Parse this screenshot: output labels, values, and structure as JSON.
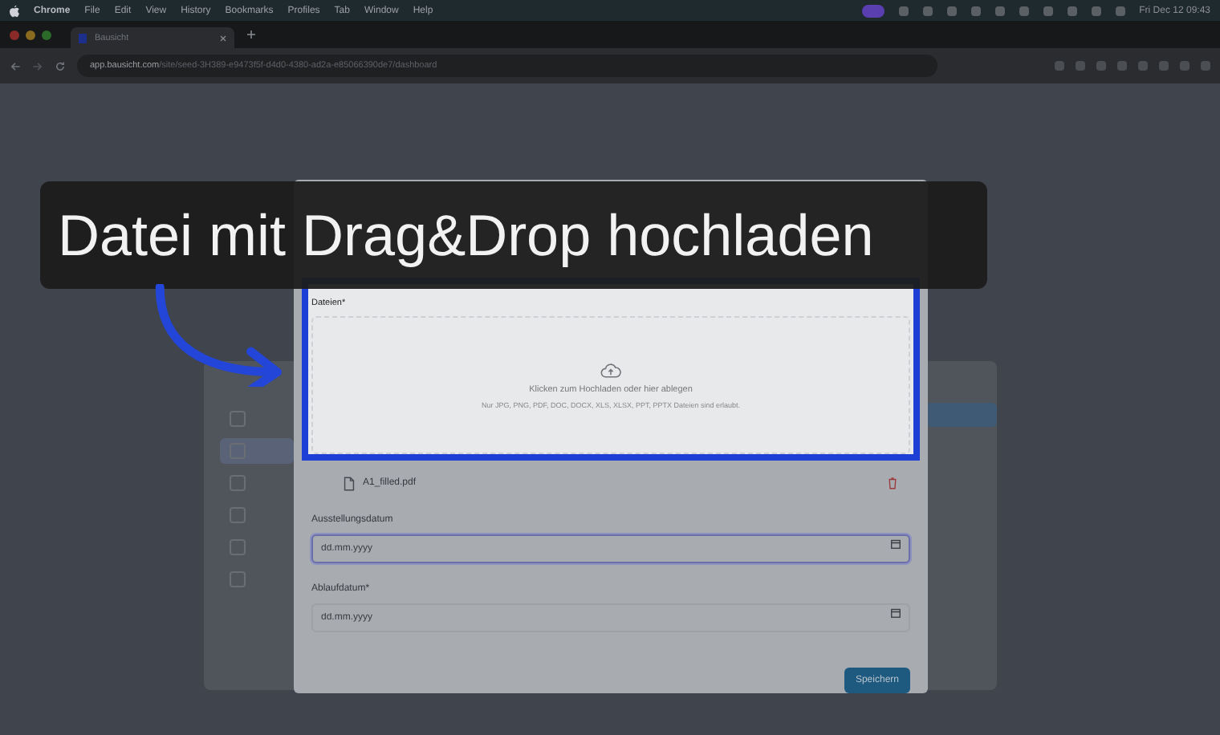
{
  "menu_bar": {
    "app": "Chrome",
    "items": [
      "File",
      "Edit",
      "View",
      "History",
      "Bookmarks",
      "Profiles",
      "Tab",
      "Window",
      "Help"
    ],
    "clock": "Fri Dec 12  09:43"
  },
  "browser": {
    "tab": {
      "title": "Bausicht",
      "selected": true
    },
    "url_domain": "app.bausicht.com",
    "url_path": "/site/seed-3H389-e9473f5f-d4d0-4380-ad2a-e85066390de7/dashboard"
  },
  "sidebar": {
    "items": [
      {
        "selected": false
      },
      {
        "selected": true
      },
      {
        "selected": false
      },
      {
        "selected": false
      },
      {
        "selected": false
      },
      {
        "selected": false
      }
    ]
  },
  "modal": {
    "upload": {
      "label": "Dateien*",
      "prompt": "Klicken zum Hochladen oder hier ablegen",
      "hint": "Nur JPG, PNG, PDF, DOC, DOCX, XLS, XLSX, PPT, PPTX Dateien sind erlaubt.",
      "highlighted": true
    },
    "files": [
      {
        "name": "A1_filled.pdf"
      }
    ],
    "fields": [
      {
        "label": "Ausstellungsdatum",
        "placeholder": "dd.mm.yyyy",
        "focused": true
      },
      {
        "label": "Ablaufdatum*",
        "placeholder": "dd.mm.yyyy",
        "focused": false
      }
    ],
    "save_button": "Speichern"
  },
  "caption": "Datei mit Drag&Drop hochladen"
}
